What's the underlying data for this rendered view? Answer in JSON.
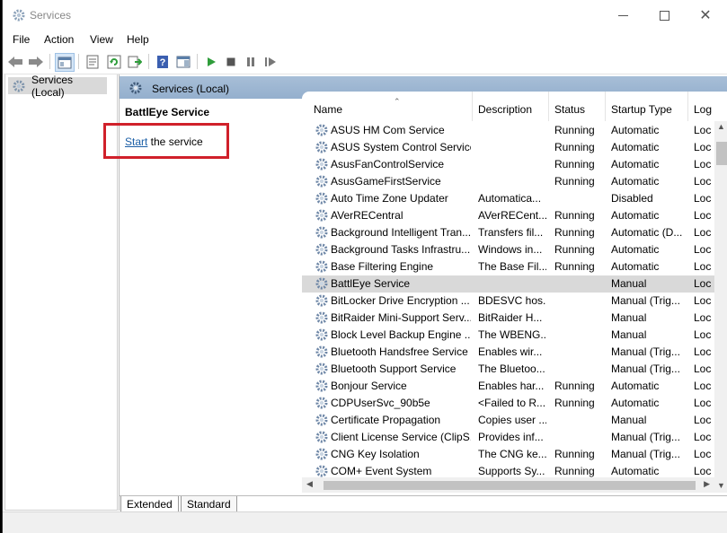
{
  "window": {
    "title": "Services"
  },
  "menu": [
    "File",
    "Action",
    "Help",
    "View"
  ],
  "menu_order": {
    "file": "File",
    "action": "Action",
    "view": "View",
    "help": "Help"
  },
  "tree": {
    "root_label": "Services (Local)"
  },
  "header": {
    "title": "Services (Local)"
  },
  "detail": {
    "service_name": "BattlEye Service",
    "start_link": "Start",
    "start_suffix": " the service"
  },
  "columns": {
    "name": "Name",
    "description": "Description",
    "status": "Status",
    "startup": "Startup Type",
    "logon": "Log"
  },
  "services": [
    {
      "name": "ASUS HM Com Service",
      "description": "",
      "status": "Running",
      "startup": "Automatic",
      "logon": "Loc"
    },
    {
      "name": "ASUS System Control Service",
      "description": "",
      "status": "Running",
      "startup": "Automatic",
      "logon": "Loc"
    },
    {
      "name": "AsusFanControlService",
      "description": "",
      "status": "Running",
      "startup": "Automatic",
      "logon": "Loc"
    },
    {
      "name": "AsusGameFirstService",
      "description": "",
      "status": "Running",
      "startup": "Automatic",
      "logon": "Loc"
    },
    {
      "name": "Auto Time Zone Updater",
      "description": "Automatica...",
      "status": "",
      "startup": "Disabled",
      "logon": "Loc"
    },
    {
      "name": "AVerRECentral",
      "description": "AVerRECent...",
      "status": "Running",
      "startup": "Automatic",
      "logon": "Loc"
    },
    {
      "name": "Background Intelligent Tran...",
      "description": "Transfers fil...",
      "status": "Running",
      "startup": "Automatic (D...",
      "logon": "Loc"
    },
    {
      "name": "Background Tasks Infrastru...",
      "description": "Windows in...",
      "status": "Running",
      "startup": "Automatic",
      "logon": "Loc"
    },
    {
      "name": "Base Filtering Engine",
      "description": "The Base Fil...",
      "status": "Running",
      "startup": "Automatic",
      "logon": "Loc"
    },
    {
      "name": "BattlEye Service",
      "description": "",
      "status": "",
      "startup": "Manual",
      "logon": "Loc"
    },
    {
      "name": "BitLocker Drive Encryption ...",
      "description": "BDESVC hos...",
      "status": "",
      "startup": "Manual (Trig...",
      "logon": "Loc"
    },
    {
      "name": "BitRaider Mini-Support Serv...",
      "description": "BitRaider H...",
      "status": "",
      "startup": "Manual",
      "logon": "Loc"
    },
    {
      "name": "Block Level Backup Engine ...",
      "description": "The WBENG...",
      "status": "",
      "startup": "Manual",
      "logon": "Loc"
    },
    {
      "name": "Bluetooth Handsfree Service",
      "description": "Enables wir...",
      "status": "",
      "startup": "Manual (Trig...",
      "logon": "Loc"
    },
    {
      "name": "Bluetooth Support Service",
      "description": "The Bluetoo...",
      "status": "",
      "startup": "Manual (Trig...",
      "logon": "Loc"
    },
    {
      "name": "Bonjour Service",
      "description": "Enables har...",
      "status": "Running",
      "startup": "Automatic",
      "logon": "Loc"
    },
    {
      "name": "CDPUserSvc_90b5e",
      "description": "<Failed to R...",
      "status": "Running",
      "startup": "Automatic",
      "logon": "Loc"
    },
    {
      "name": "Certificate Propagation",
      "description": "Copies user ...",
      "status": "",
      "startup": "Manual",
      "logon": "Loc"
    },
    {
      "name": "Client License Service (ClipS...",
      "description": "Provides inf...",
      "status": "",
      "startup": "Manual (Trig...",
      "logon": "Loc"
    },
    {
      "name": "CNG Key Isolation",
      "description": "The CNG ke...",
      "status": "Running",
      "startup": "Manual (Trig...",
      "logon": "Loc"
    },
    {
      "name": "COM+ Event System",
      "description": "Supports Sy...",
      "status": "Running",
      "startup": "Automatic",
      "logon": "Loc"
    }
  ],
  "selected_service": "BattlEye Service",
  "tabs": {
    "extended": "Extended",
    "standard": "Standard"
  },
  "colors": {
    "header_band": "#a7bed7",
    "selection": "#d9d9d9",
    "highlight_box": "#d0202a",
    "link": "#1a5ea6"
  }
}
